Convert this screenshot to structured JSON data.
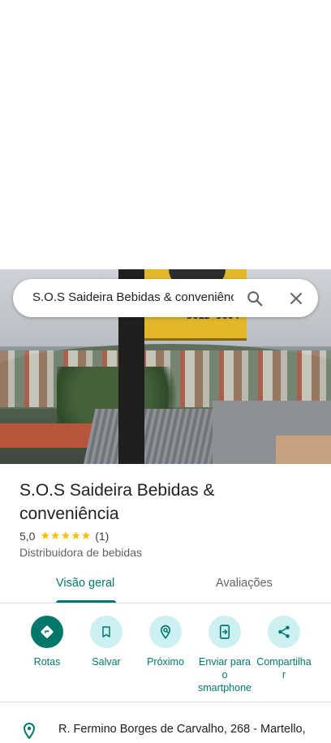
{
  "search": {
    "query": "S.O.S Saideira Bebidas & conveniênc"
  },
  "photo": {
    "sign_number": "3612-5604"
  },
  "place": {
    "title": "S.O.S Saideira Bebidas & conveniência",
    "rating": "5,0",
    "stars": "★★★★★",
    "review_count": "(1)",
    "category": "Distribuidora de bebidas"
  },
  "tabs": {
    "overview": "Visão geral",
    "reviews": "Avaliações"
  },
  "actions": {
    "directions": "Rotas",
    "save": "Salvar",
    "nearby": "Próximo",
    "send_line1": "Enviar para",
    "send_line2": "o",
    "send_line3": "smartphone",
    "share_line1": "Compartilha",
    "share_line2": "r"
  },
  "address": "R. Fermino Borges de Carvalho, 268 - Martello,",
  "icons": [
    "search-icon",
    "close-icon",
    "directions-icon",
    "bookmark-icon",
    "nearby-icon",
    "send-to-phone-icon",
    "share-icon",
    "location-pin-icon"
  ],
  "colors": {
    "accent": "#00796b",
    "action_bg": "#cdf0f3",
    "star": "#fbbc04"
  }
}
